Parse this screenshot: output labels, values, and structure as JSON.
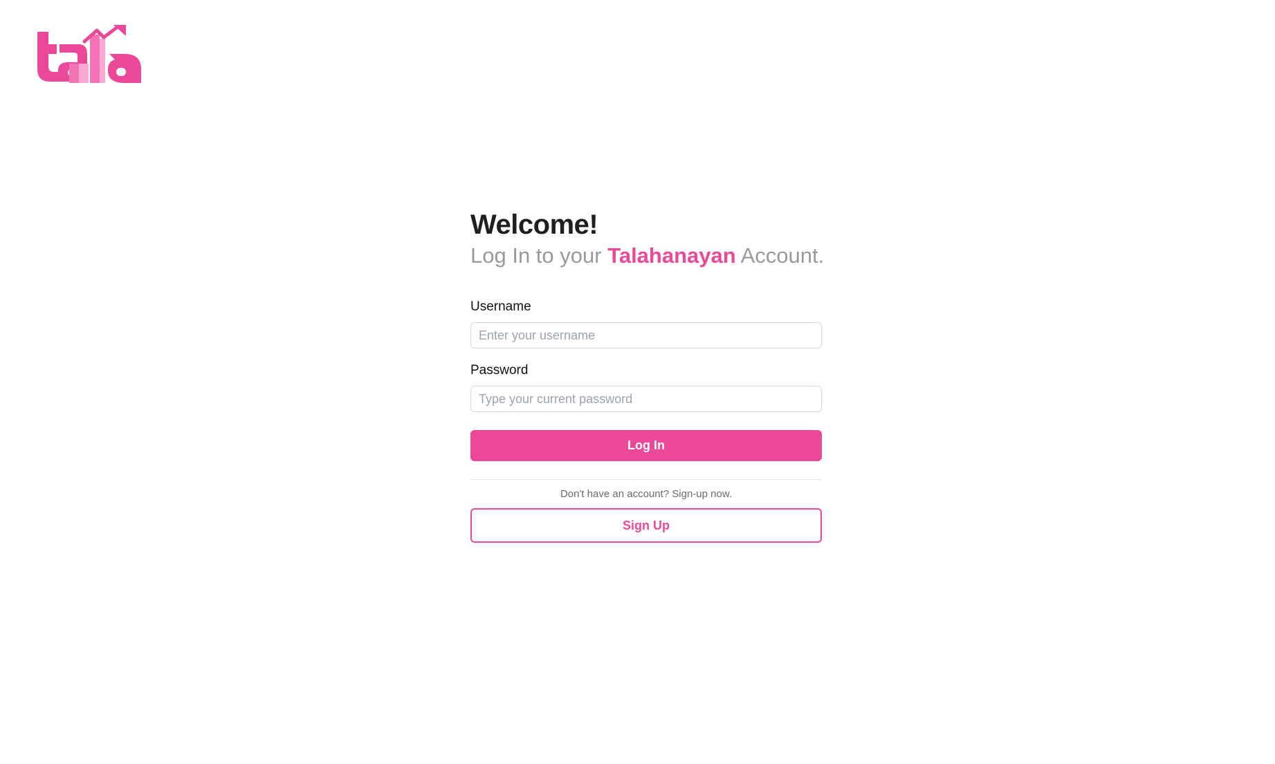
{
  "logo": {
    "icon": "tala-logo",
    "colors": {
      "primary": "#ec4899",
      "light": "#f472b6",
      "lighter": "#f9a8d4"
    }
  },
  "heading": {
    "welcome": "Welcome!",
    "subtitle_prefix": "Log In to your ",
    "brand": "Talahanayan",
    "subtitle_suffix": " Account."
  },
  "form": {
    "username": {
      "label": "Username",
      "placeholder": "Enter your username",
      "value": ""
    },
    "password": {
      "label": "Password",
      "placeholder": "Type your current password",
      "value": ""
    },
    "login_button": "Log In"
  },
  "signup": {
    "hint": "Don't have an account? Sign-up now.",
    "button": "Sign Up"
  },
  "theme": {
    "accent": "#ec4899",
    "text": "#1f1f1f",
    "muted": "#9a9a9a"
  }
}
